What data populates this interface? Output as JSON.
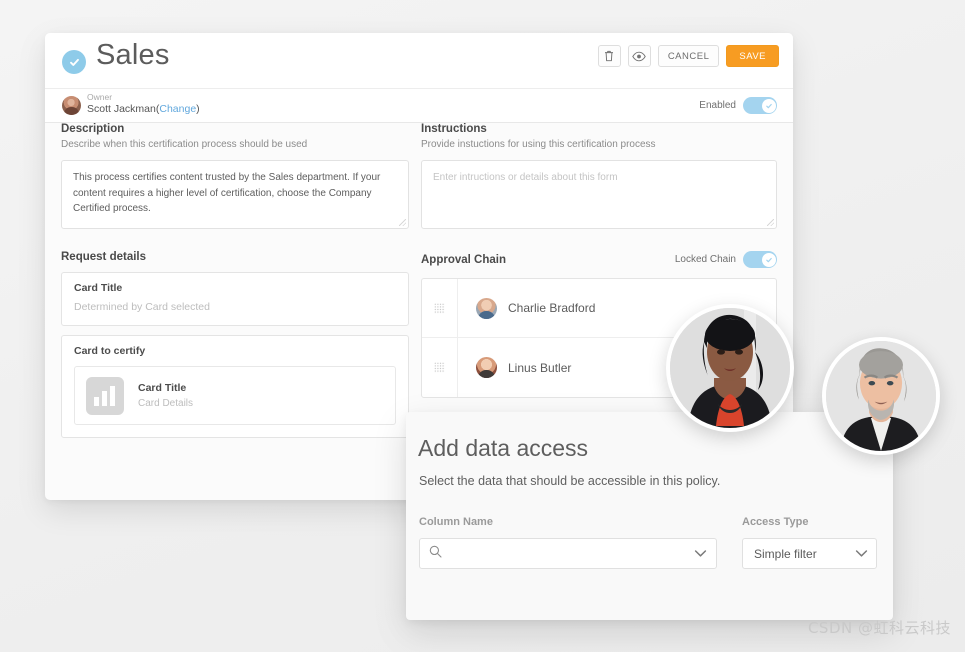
{
  "header": {
    "title": "Sales",
    "status_icon": "check-circle-icon",
    "accent_blue": "#8ecbe9",
    "actions": {
      "delete_icon": "trash-icon",
      "preview_icon": "eye-icon",
      "cancel_label": "CANCEL",
      "save_label": "SAVE",
      "save_color": "#f79c22"
    }
  },
  "owner": {
    "label": "Owner",
    "name": "Scott Jackman",
    "change_label": "Change",
    "open_paren": "(",
    "close_paren": ")",
    "enabled_label": "Enabled",
    "enabled_state": true
  },
  "description": {
    "title": "Description",
    "subtitle": "Describe when this certification process should be used",
    "value": "This process certifies content trusted by the Sales department. If your content requires a higher level of certification, choose the Company Certified process."
  },
  "instructions": {
    "title": "Instructions",
    "subtitle": "Provide instuctions for using this certification process",
    "placeholder": "Enter intructions or details about this form",
    "value": ""
  },
  "request_details": {
    "title": "Request details",
    "card_title_label": "Card Title",
    "card_title_ghost": "Determined by Card selected",
    "card_to_certify_label": "Card to certify",
    "thumb_icon": "bar-chart-icon",
    "certify_card_title": "Card Title",
    "certify_card_details": "Card Details"
  },
  "approval_chain": {
    "title": "Approval Chain",
    "locked_label": "Locked Chain",
    "locked_state": true,
    "drag_icon": "drag-handle-icon",
    "members": [
      {
        "name": "Charlie Bradford",
        "avatar": "avatar-charlie-bradford"
      },
      {
        "name": "Linus Butler",
        "avatar": "avatar-linus-butler"
      }
    ]
  },
  "modal": {
    "title": "Add data access",
    "subtitle": "Select the data that should be accessible in this policy.",
    "column_name_label": "Column Name",
    "column_name_value": "",
    "column_name_placeholder": "",
    "search_icon": "search-icon",
    "dropdown_icon": "chevron-down-icon",
    "access_type_label": "Access Type",
    "access_type_value": "Simple filter"
  },
  "portraits": [
    {
      "name": "portrait-woman"
    },
    {
      "name": "portrait-man"
    }
  ],
  "watermark": "CSDN @虹科云科技"
}
